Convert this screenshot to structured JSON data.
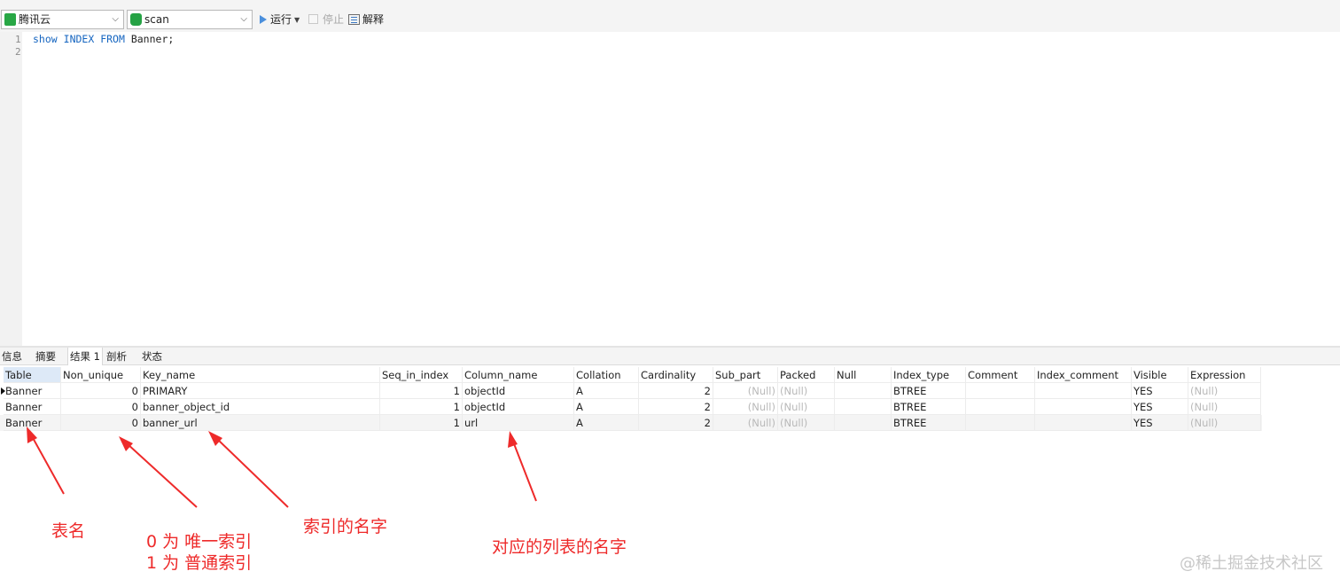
{
  "toolbar": {
    "connection": {
      "name": "腾讯云",
      "icon": "tencent-cloud-connection-icon",
      "color": "#28a745"
    },
    "database": {
      "name": "scan",
      "icon": "database-icon",
      "color": "#25a244"
    },
    "run_label": "运行",
    "stop_label": "停止",
    "explain_label": "解释"
  },
  "editor": {
    "line_numbers": [
      "1",
      "2"
    ],
    "lines": [
      [
        {
          "t": "show",
          "kw": true
        },
        {
          "t": " ",
          "kw": false
        },
        {
          "t": "INDEX",
          "kw": true
        },
        {
          "t": " ",
          "kw": false
        },
        {
          "t": "FROM",
          "kw": true
        },
        {
          "t": " Banner;",
          "kw": false
        }
      ],
      []
    ]
  },
  "result_tabs": {
    "info": "信息",
    "summary": "摘要",
    "result1": "结果 1",
    "profile": "剖析",
    "status": "状态"
  },
  "grid": {
    "columns": [
      "Table",
      "Non_unique",
      "Key_name",
      "Seq_in_index",
      "Column_name",
      "Collation",
      "Cardinality",
      "Sub_part",
      "Packed",
      "Null",
      "Index_type",
      "Comment",
      "Index_comment",
      "Visible",
      "Expression"
    ],
    "rows": [
      [
        "Banner",
        "0",
        "PRIMARY",
        "1",
        "objectId",
        "A",
        "2",
        "(Null)",
        "(Null)",
        "",
        "BTREE",
        "",
        "",
        "YES",
        "(Null)"
      ],
      [
        "Banner",
        "0",
        "banner_object_id",
        "1",
        "objectId",
        "A",
        "2",
        "(Null)",
        "(Null)",
        "",
        "BTREE",
        "",
        "",
        "YES",
        "(Null)"
      ],
      [
        "Banner",
        "0",
        "banner_url",
        "1",
        "url",
        "A",
        "2",
        "(Null)",
        "(Null)",
        "",
        "BTREE",
        "",
        "",
        "YES",
        "(Null)"
      ]
    ]
  },
  "annotations": {
    "color": "#ee2a2a",
    "table_name": "表名",
    "unique_line1": "0 为 唯一索引",
    "unique_line2": "1 为 普通索引",
    "index_name": "索引的名字",
    "column_name": "对应的列表的名字"
  },
  "watermark": "@稀土掘金技术社区"
}
